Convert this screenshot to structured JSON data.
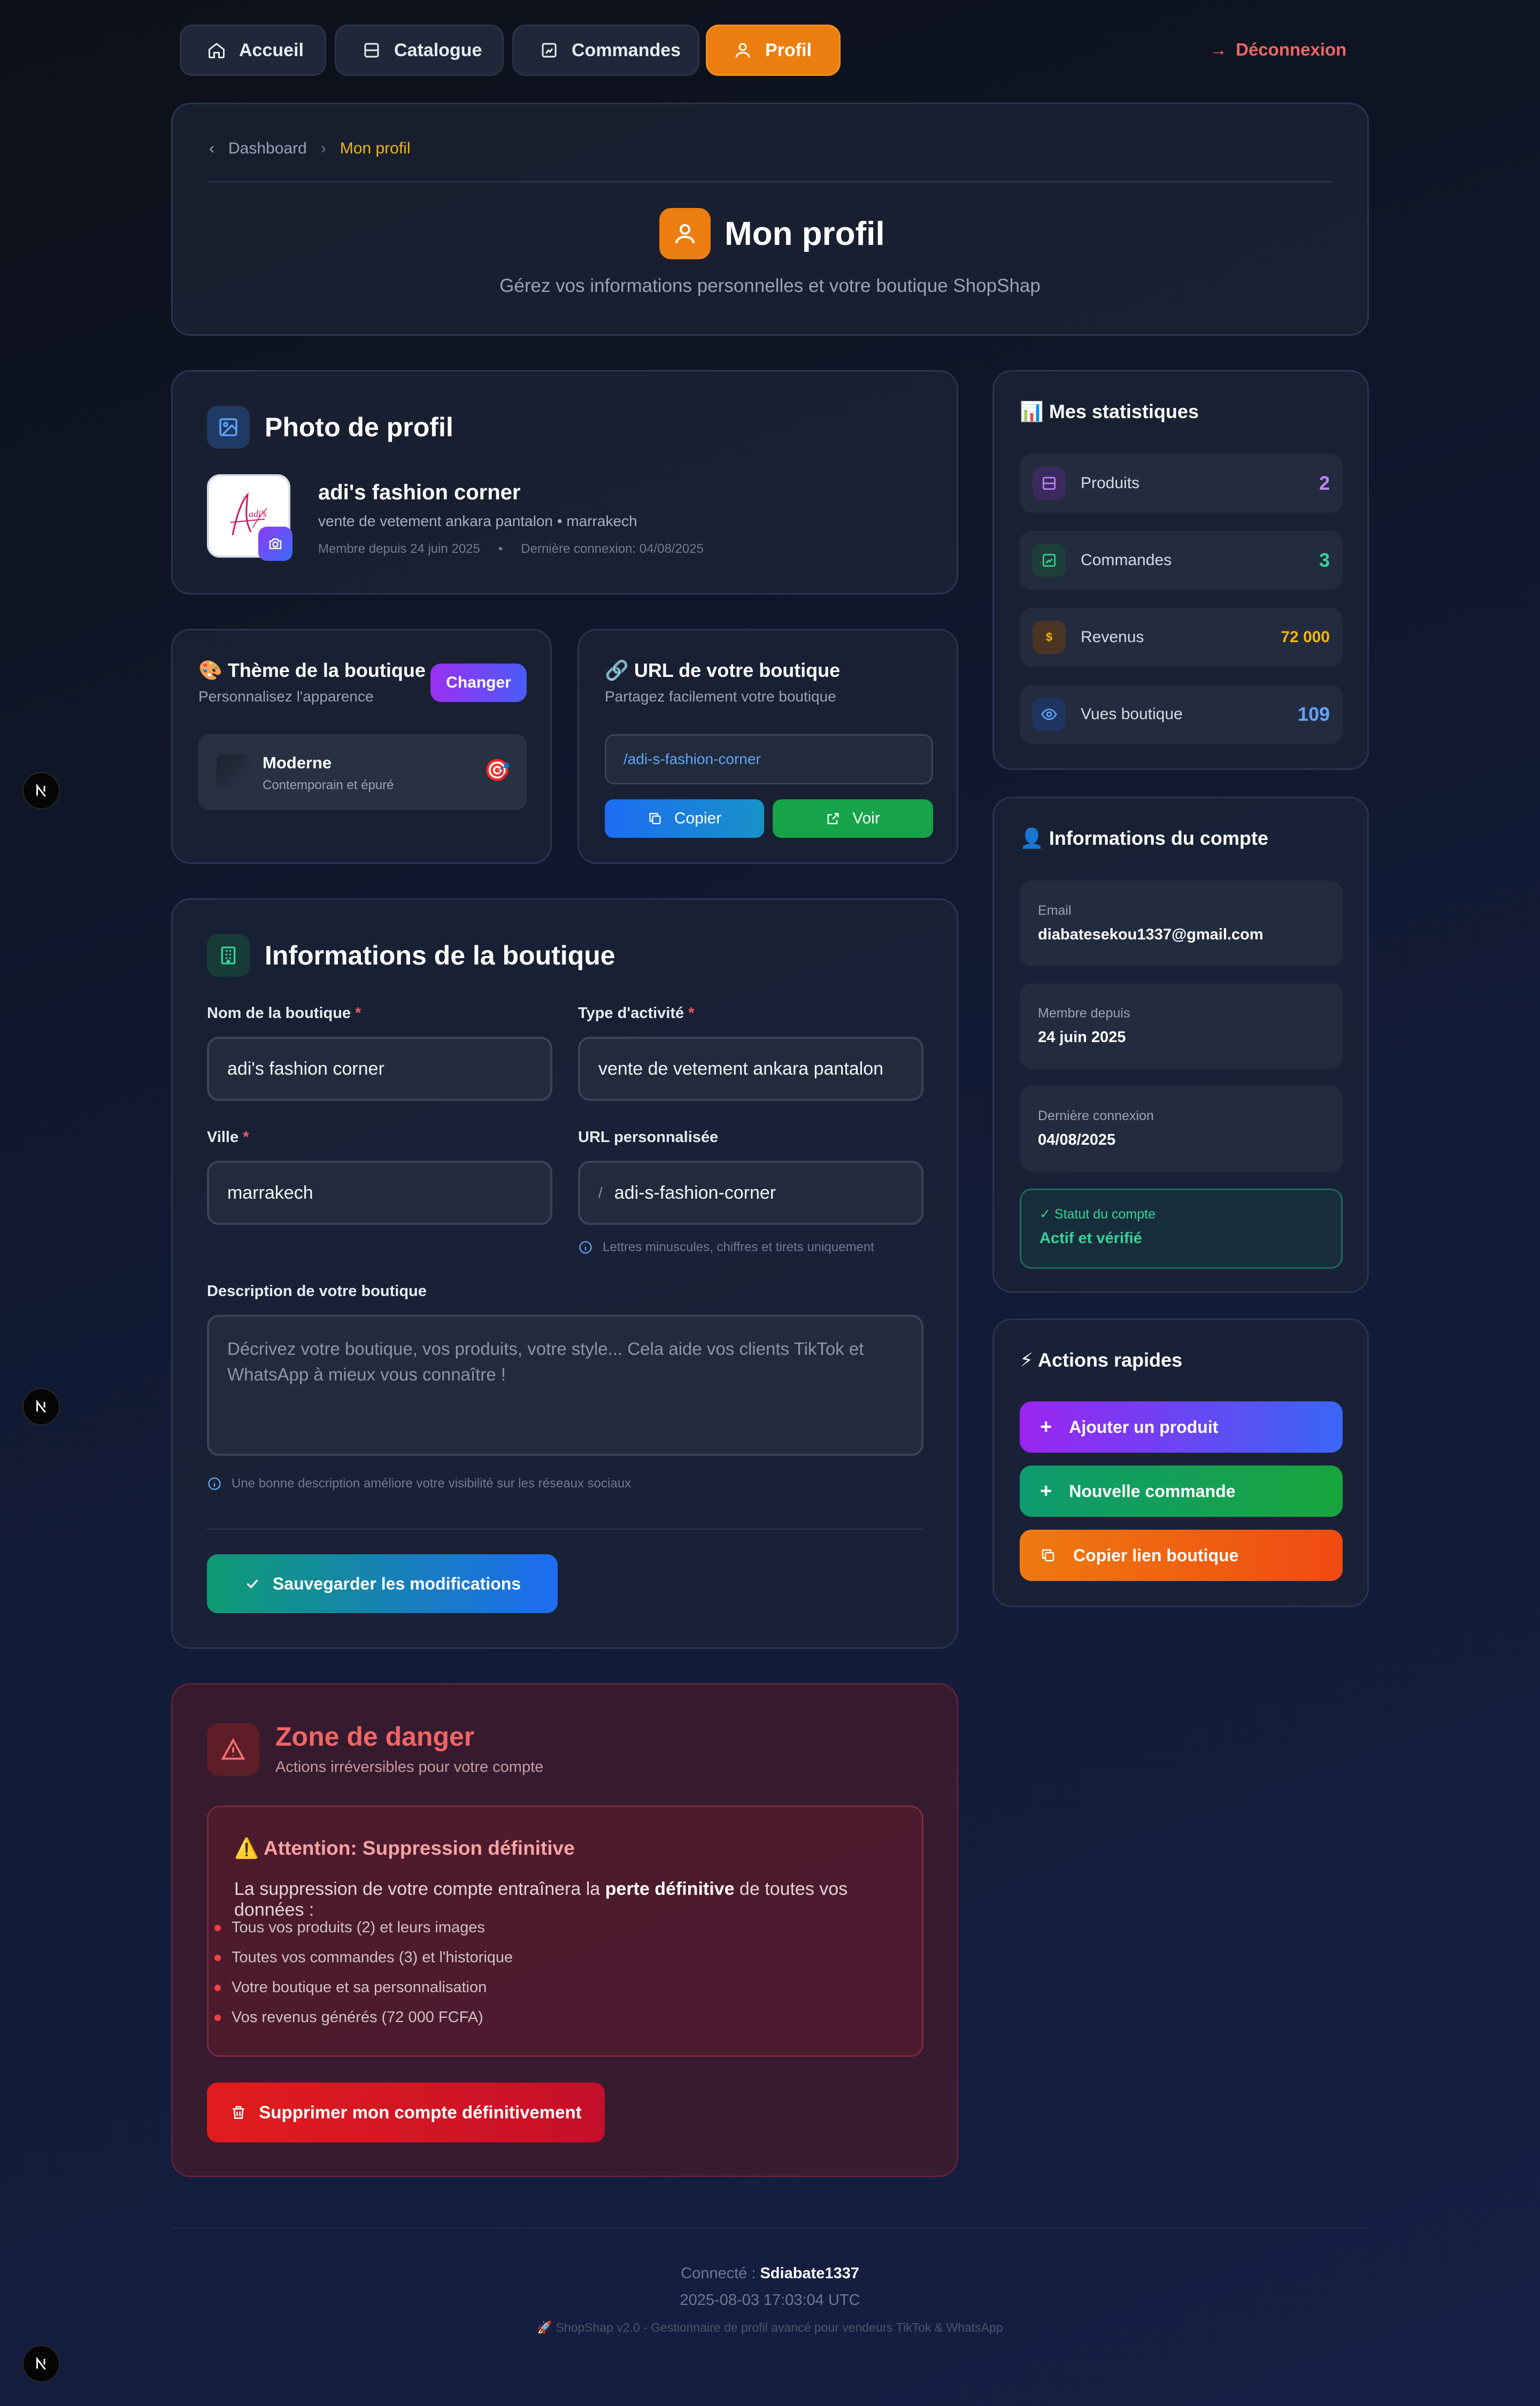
{
  "nav": {
    "items": [
      {
        "label": "Accueil",
        "icon": "home-icon"
      },
      {
        "label": "Catalogue",
        "icon": "catalog-icon"
      },
      {
        "label": "Commandes",
        "icon": "orders-icon"
      },
      {
        "label": "Profil",
        "icon": "user-icon"
      }
    ],
    "logout": "Déconnexion"
  },
  "header": {
    "breadcrumb_parent": "Dashboard",
    "breadcrumb_current": "Mon profil",
    "title": "Mon profil",
    "subtitle": "Gérez vos informations personnelles et votre boutique ShopShap"
  },
  "photo": {
    "section_title": "Photo de profil",
    "shop_name": "adi's fashion corner",
    "description": "vente de vetement ankara pantalon • marrakech",
    "member_since": "Membre depuis 24 juin 2025",
    "separator": "•",
    "last_login": "Dernière connexion: 04/08/2025",
    "avatar_text": "adi's"
  },
  "theme": {
    "title": "🎨 Thème de la boutique",
    "subtitle": "Personnalisez l'apparence",
    "change_button": "Changer",
    "name": "Moderne",
    "desc": "Contemporain et épuré",
    "emoji": "🎯"
  },
  "url": {
    "title": "🔗 URL de votre boutique",
    "subtitle": "Partagez facilement votre boutique",
    "value": "/adi-s-fashion-corner",
    "copy_button": "Copier",
    "view_button": "Voir"
  },
  "shop_info": {
    "title": "Informations de la boutique",
    "name_label": "Nom de la boutique",
    "name_value": "adi's fashion corner",
    "activity_label": "Type d'activité",
    "activity_value": "vente de vetement ankara pantalon",
    "city_label": "Ville",
    "city_value": "marrakech",
    "custom_url_label": "URL personnalisée",
    "custom_url_prefix": "/",
    "custom_url_value": "adi-s-fashion-corner",
    "url_hint": "Lettres minuscules, chiffres et tirets uniquement",
    "desc_label": "Description de votre boutique",
    "desc_placeholder": "Décrivez votre boutique, vos produits, votre style... Cela aide vos clients TikTok et WhatsApp à mieux vous connaître !",
    "desc_hint": "Une bonne description améliore votre visibilité sur les réseaux sociaux",
    "required_mark": "*",
    "save_button": "Sauvegarder les modifications"
  },
  "danger": {
    "title": "Zone de danger",
    "subtitle": "Actions irréversibles pour votre compte",
    "warning_title": "⚠️ Attention: Suppression définitive",
    "warning_text_before": "La suppression de votre compte entraînera la ",
    "warning_text_bold": "perte définitive",
    "warning_text_after": " de toutes vos données :",
    "items": [
      "Tous vos produits (2) et leurs images",
      "Toutes vos commandes (3) et l'historique",
      "Votre boutique et sa personnalisation",
      "Vos revenus générés (72 000 FCFA)"
    ],
    "delete_button": "Supprimer mon compte définitivement"
  },
  "stats": {
    "title": "📊 Mes statistiques",
    "rows": [
      {
        "label": "Produits",
        "value": "2",
        "color": "#c084fc"
      },
      {
        "label": "Commandes",
        "value": "3",
        "color": "#34d399"
      },
      {
        "label": "Revenus",
        "value": "72 000",
        "color": "#f5b50c"
      },
      {
        "label": "Vues boutique",
        "value": "109",
        "color": "#60a5fa"
      }
    ],
    "revenue_symbol": "$"
  },
  "account": {
    "title": "👤 Informations du compte",
    "email_label": "Email",
    "email_value": "diabatesekou1337@gmail.com",
    "member_label": "Membre depuis",
    "member_value": "24 juin 2025",
    "login_label": "Dernière connexion",
    "login_value": "04/08/2025",
    "status_label": "✓  Statut du compte",
    "status_value": "Actif et vérifié"
  },
  "actions": {
    "title": "⚡ Actions rapides",
    "add_product": "Ajouter un produit",
    "new_order": "Nouvelle commande",
    "copy_link": "Copier lien boutique"
  },
  "footer": {
    "connected_label": "Connecté :",
    "username": "Sdiabate1337",
    "timestamp": "2025-08-03 17:03:04 UTC",
    "version": "🚀 ShopShap v2.0 - Gestionnaire de profil avancé pour vendeurs TikTok & WhatsApp"
  },
  "colors": {
    "accent": "#ec7e0f",
    "danger": "#ef4444",
    "success": "#10b981"
  }
}
